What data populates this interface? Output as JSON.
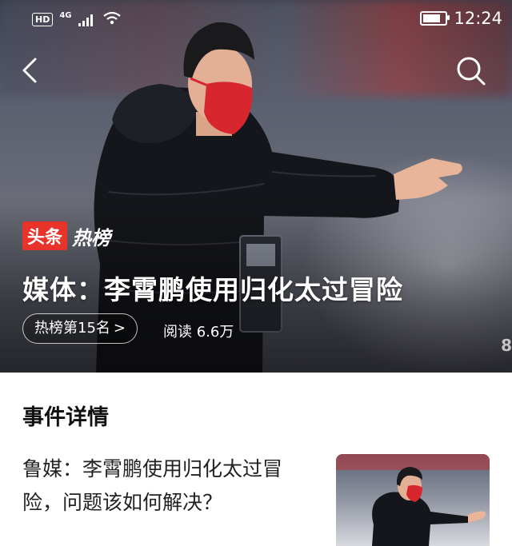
{
  "status_bar": {
    "hd": "HD",
    "network": "4G",
    "time": "12:24"
  },
  "icons": {
    "back": "chevron-left-icon",
    "search": "search-icon"
  },
  "hero": {
    "brand_tag": "头条",
    "brand_hot": "热榜",
    "headline": "媒体：李霄鹏使用归化太过冒险",
    "rank_label": "热榜第15名",
    "rank_chevron": ">",
    "reads": "阅读 6.6万",
    "watermark": "8"
  },
  "event": {
    "section_title": "事件详情",
    "article_title": "鲁媒：李霄鹏使用归化太过冒险，问题该如何解决？"
  },
  "colors": {
    "brand_red": "#e8332a",
    "mask_red": "#d8262f",
    "jacket": "#15161b"
  }
}
